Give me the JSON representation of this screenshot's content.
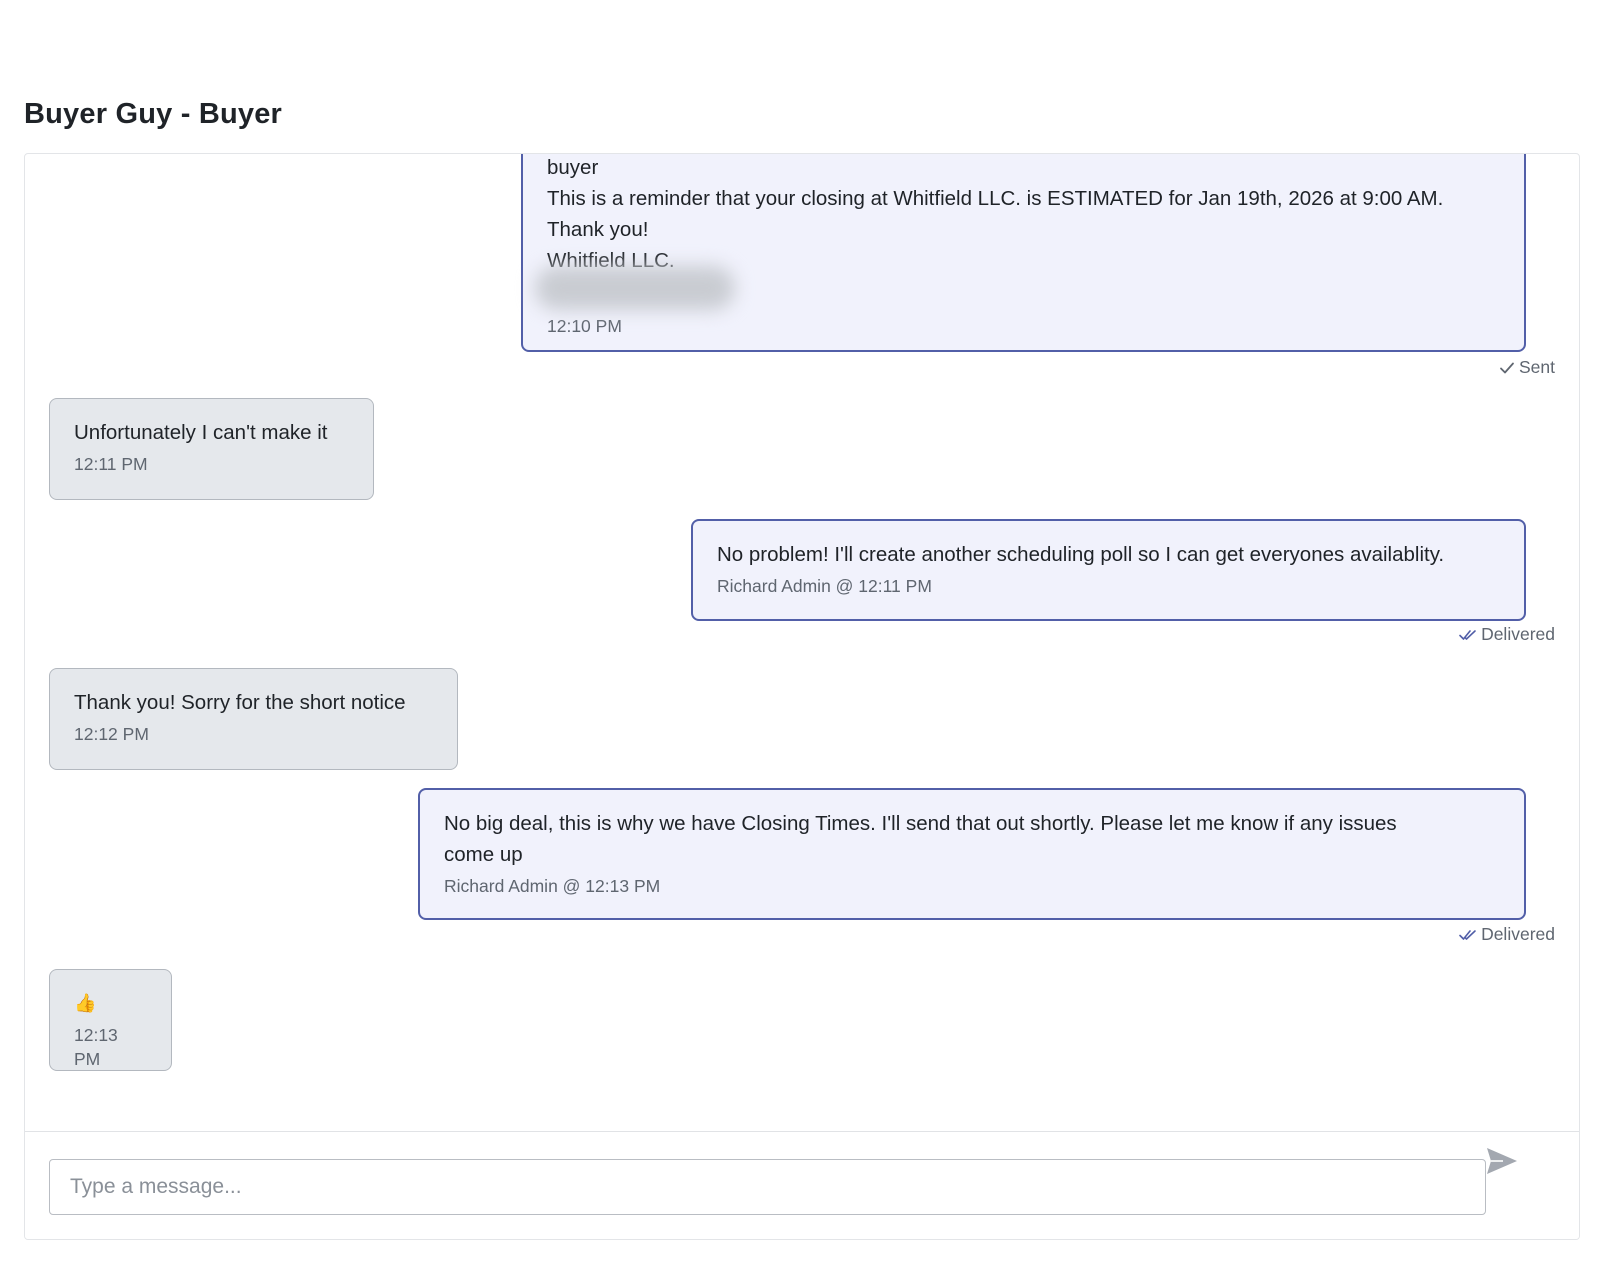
{
  "conversation": {
    "title": "Buyer Guy - Buyer"
  },
  "messages": [
    {
      "direction": "out",
      "lines": [
        "buyer",
        "This is a reminder that your closing at Whitfield LLC. is ESTIMATED for Jan 19th, 2026 at 9:00 AM.",
        "Thank you!",
        "Whitfield LLC."
      ],
      "meta": "12:10 PM",
      "status": "Sent"
    },
    {
      "direction": "in",
      "lines": [
        "Unfortunately I can't make it"
      ],
      "meta": "12:11 PM"
    },
    {
      "direction": "out",
      "lines": [
        "No problem! I'll create another scheduling poll so I can get everyones availablity."
      ],
      "meta": "Richard Admin @ 12:11 PM",
      "status": "Delivered"
    },
    {
      "direction": "in",
      "lines": [
        "Thank you! Sorry for the short notice"
      ],
      "meta": "12:12 PM"
    },
    {
      "direction": "out",
      "lines": [
        "No big deal, this is why we have Closing Times. I'll send that out shortly. Please let me know if any issues",
        "come up"
      ],
      "meta": "Richard Admin @ 12:13 PM",
      "status": "Delivered"
    },
    {
      "direction": "in",
      "lines": [
        "👍"
      ],
      "meta": "12:13 PM"
    }
  ],
  "composer": {
    "placeholder": "Type a message...",
    "value": "",
    "send_icon": "send-icon"
  },
  "icons": {
    "sent": "check-icon",
    "delivered": "double-check-icon"
  },
  "colors": {
    "outgoing_bg": "#f1f2fc",
    "outgoing_border": "#525fa8",
    "incoming_bg": "#e5e8ec",
    "incoming_border": "#b3b8bf"
  }
}
